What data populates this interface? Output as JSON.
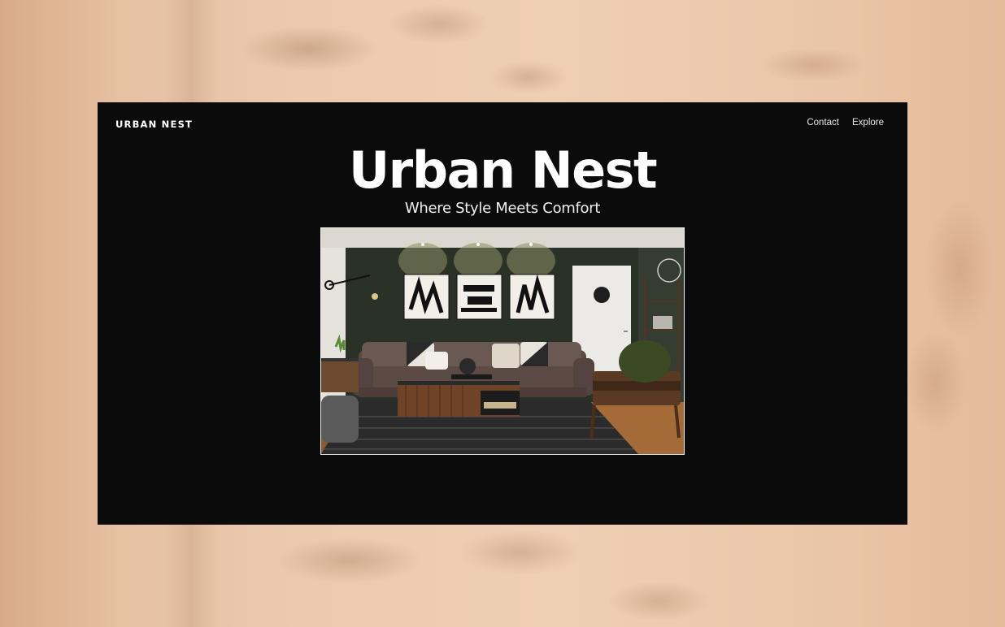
{
  "site": {
    "logo": "URBAN NEST",
    "nav": [
      {
        "label": "Contact"
      },
      {
        "label": "Explore"
      }
    ],
    "hero": {
      "title": "Urban Nest",
      "subtitle": "Where Style Meets Comfort",
      "image_icon": "living-room-photo"
    }
  },
  "colors": {
    "background_wall": "#e9c6a6",
    "site_background": "#0b0b0b",
    "text": "#ffffff",
    "accent_wall": "#2c3328"
  }
}
